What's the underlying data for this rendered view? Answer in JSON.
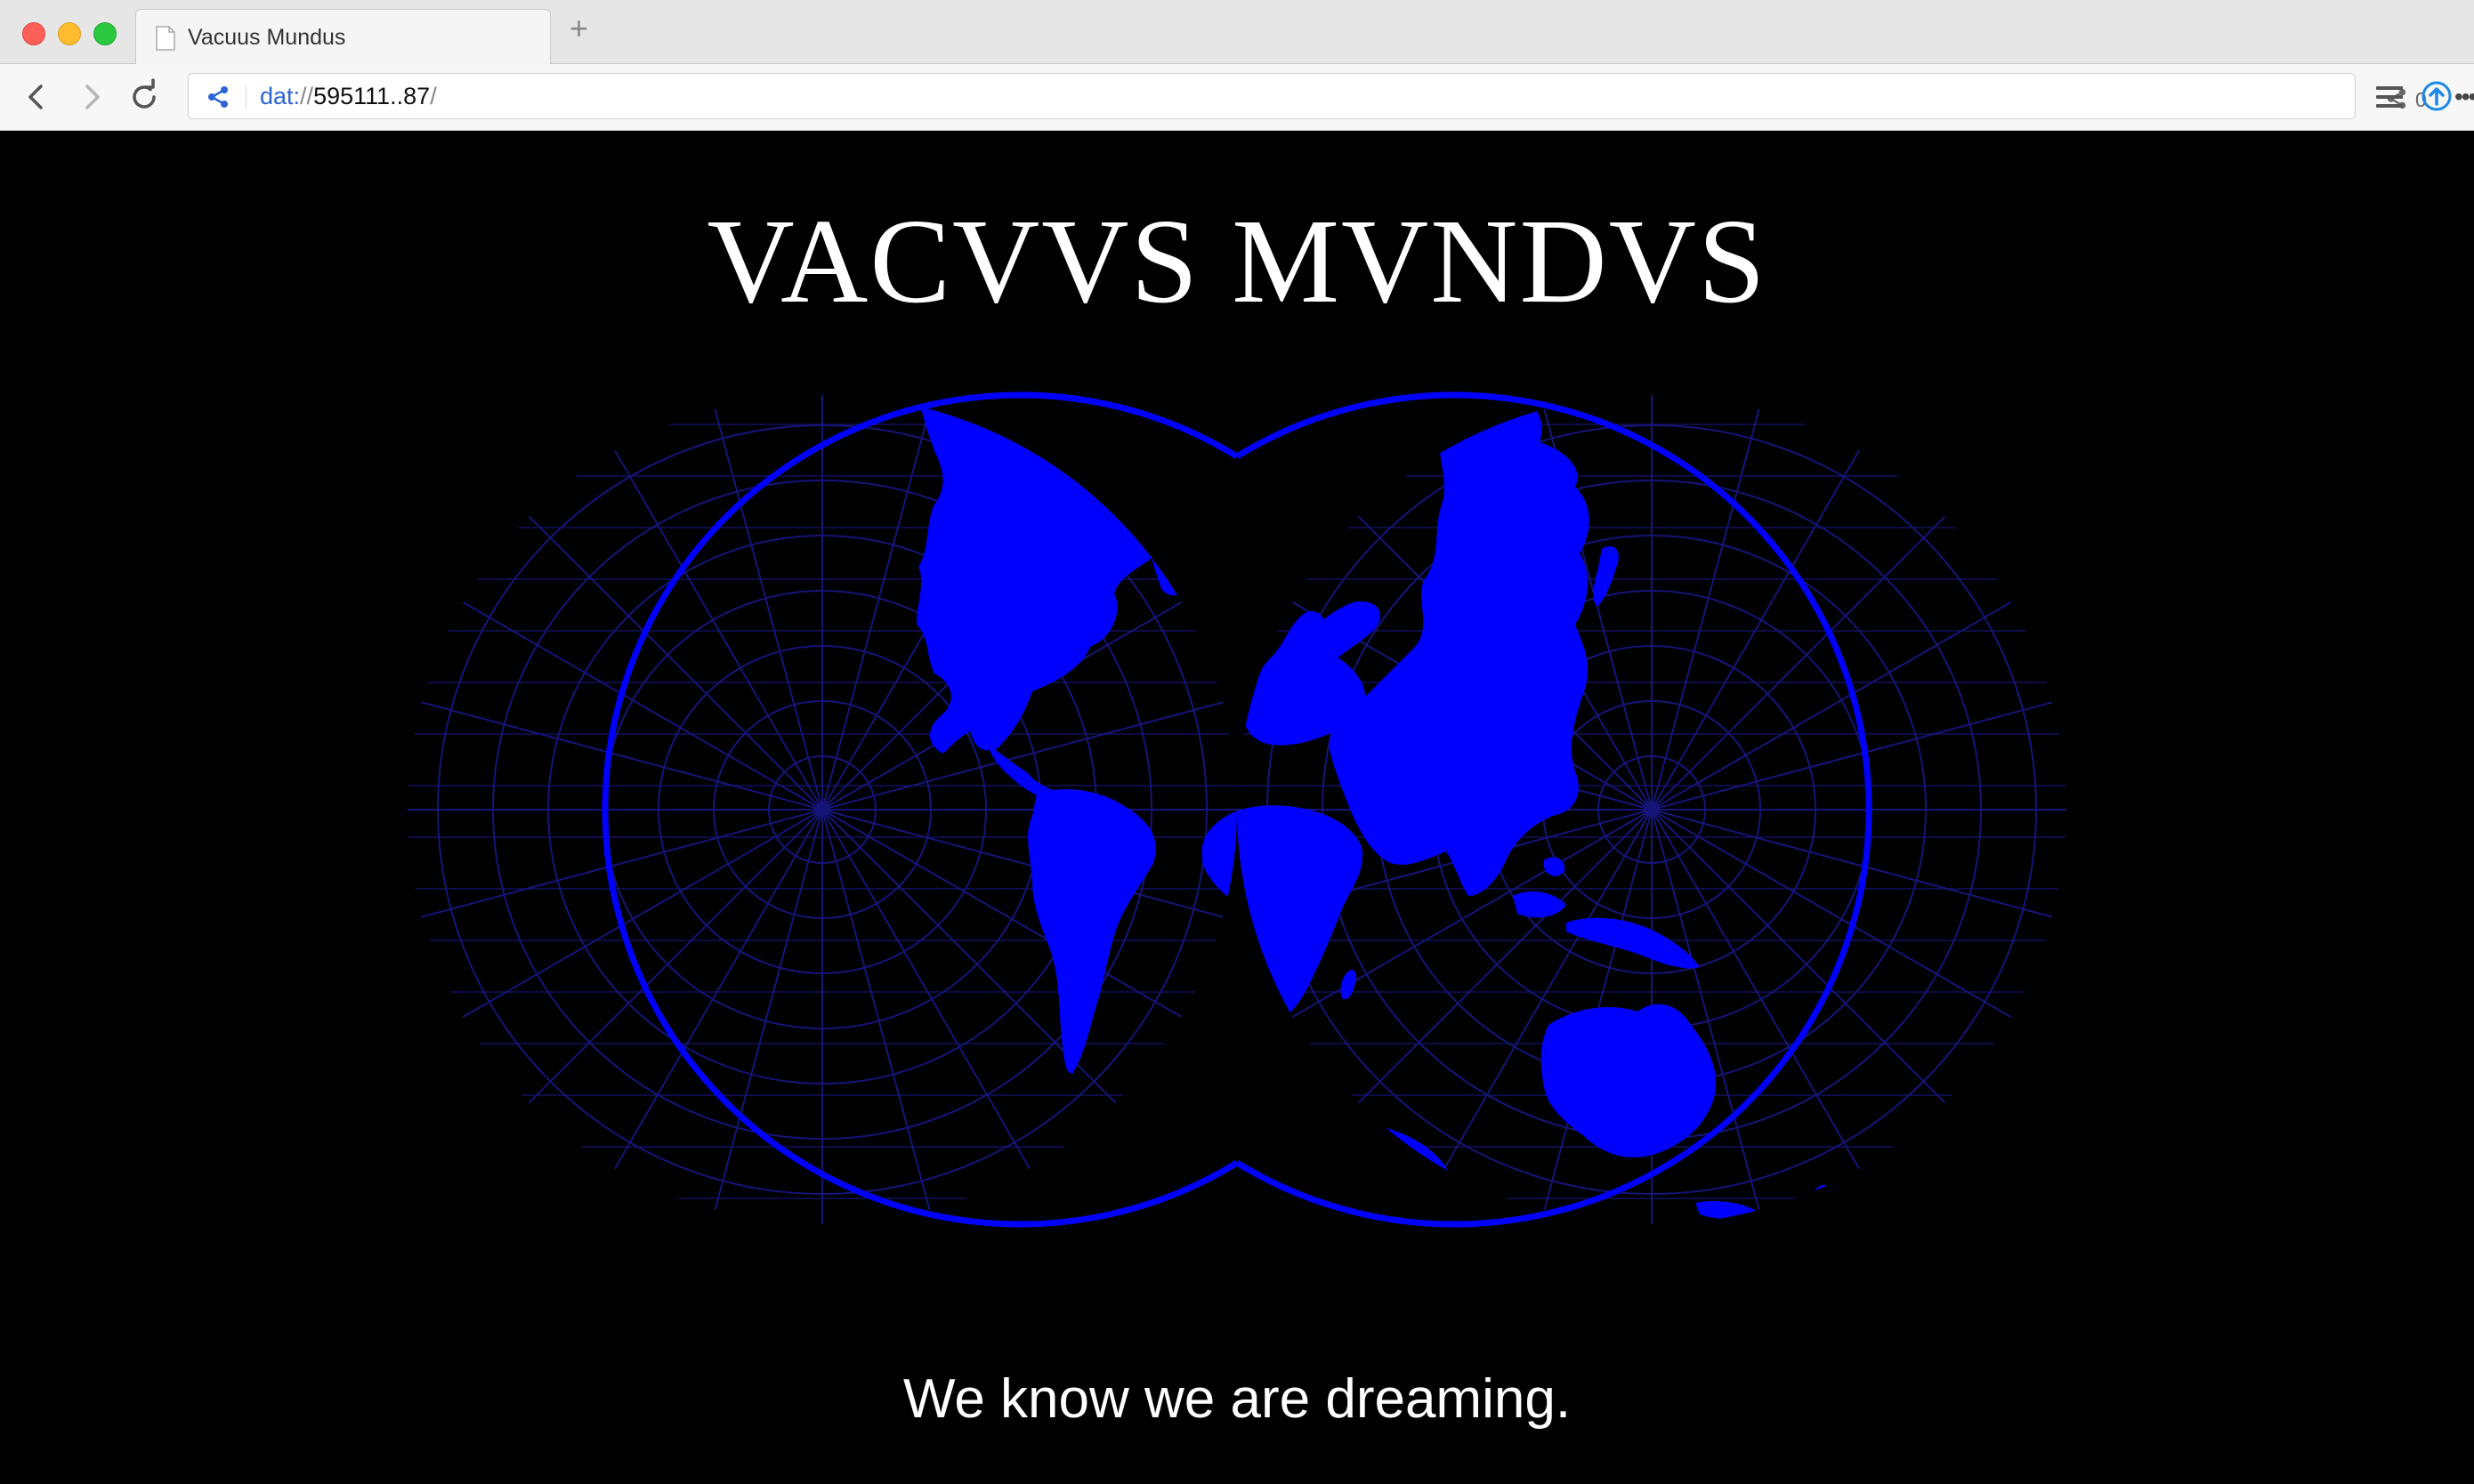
{
  "window": {
    "tab_title": "Vacuus Mundus",
    "new_tab_label": "+"
  },
  "address_bar": {
    "scheme": "dat:",
    "slashes": "//",
    "host": "595111..87",
    "trailing": "/"
  },
  "toolbar": {
    "peer_count": "0",
    "more_label": "•••"
  },
  "page": {
    "title": "VACVVS MVNDVS",
    "tagline": "We know we are dreaming."
  },
  "colors": {
    "map_blue": "#0000ff",
    "graticule": "#111166",
    "background": "#000000"
  }
}
